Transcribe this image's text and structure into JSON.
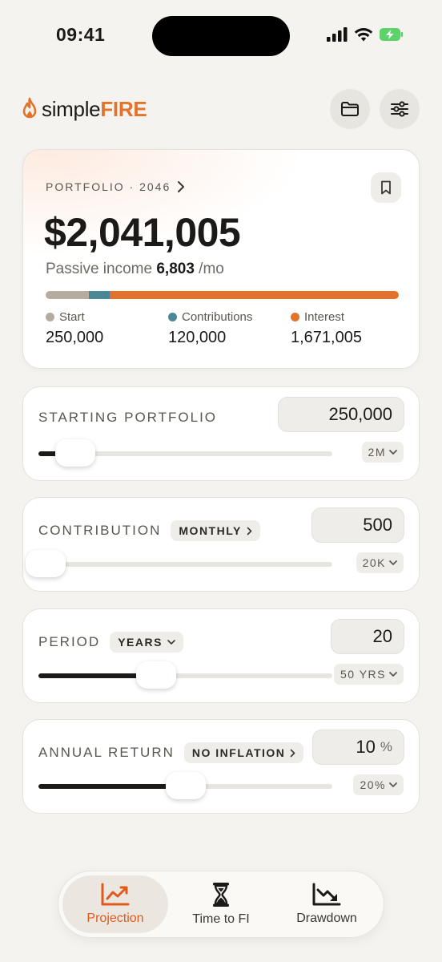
{
  "status": {
    "time": "09:41"
  },
  "app": {
    "name_prefix": "simple",
    "name_suffix": "FIRE"
  },
  "portfolio": {
    "label": "PORTFOLIO · 2046",
    "value": "$2,041,005",
    "passive_prefix": "Passive income",
    "passive_value": "6,803",
    "passive_suffix": "/mo",
    "breakdown": [
      {
        "name": "Start",
        "value": "250,000",
        "color": "#b5aba0",
        "fraction": 0.1225
      },
      {
        "name": "Contributions",
        "value": "120,000",
        "color": "#4a8898",
        "fraction": 0.0588
      },
      {
        "name": "Interest",
        "value": "1,671,005",
        "color": "#e4722a",
        "fraction": 0.8187
      }
    ]
  },
  "inputs": {
    "starting": {
      "label": "STARTING PORTFOLIO",
      "value": "250,000",
      "max": "2M",
      "slider_fraction": 0.125
    },
    "contribution": {
      "label": "CONTRIBUTION",
      "chip": "MONTHLY",
      "value": "500",
      "max": "20K",
      "slider_fraction": 0.025
    },
    "period": {
      "label": "PERIOD",
      "chip": "YEARS",
      "value": "20",
      "max": "50 YRS",
      "slider_fraction": 0.4
    },
    "return": {
      "label": "ANNUAL RETURN",
      "chip": "NO INFLATION",
      "value": "10",
      "unit": "%",
      "max": "20%",
      "slider_fraction": 0.5
    }
  },
  "tabs": [
    {
      "label": "Projection",
      "icon": "chart-line-icon",
      "active": true
    },
    {
      "label": "Time to FI",
      "icon": "hourglass-icon",
      "active": false
    },
    {
      "label": "Drawdown",
      "icon": "chart-down-icon",
      "active": false
    }
  ],
  "colors": {
    "accent": "#e4722a",
    "background": "#f4f3ef"
  }
}
